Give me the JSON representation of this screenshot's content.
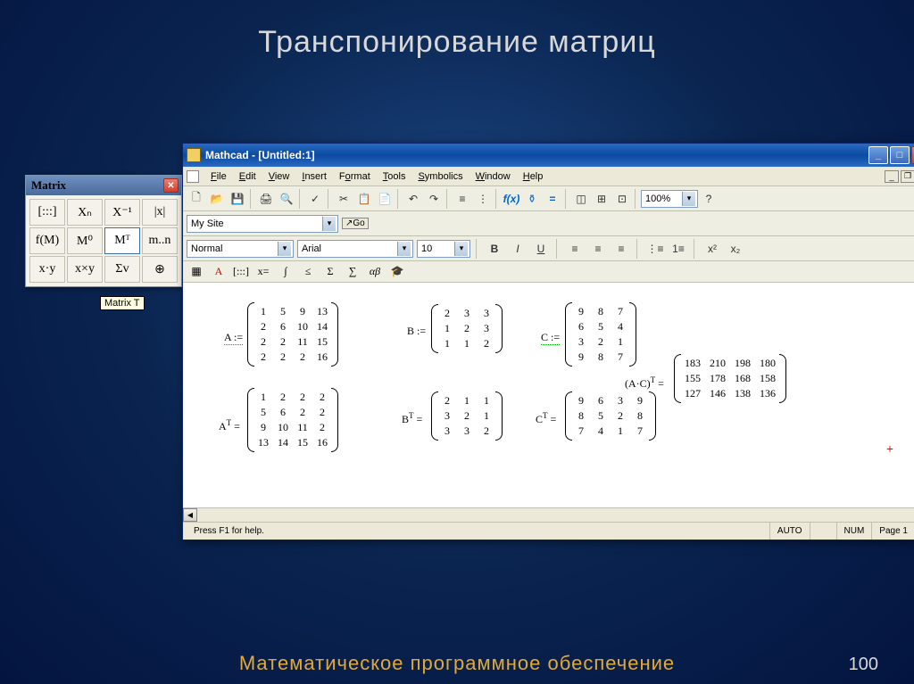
{
  "slide": {
    "title": "Транспонирование матриц",
    "footer": "Математическое программное обеспечение",
    "pagenum": "100"
  },
  "matrix_palette": {
    "title": "Matrix",
    "tooltip": "Matrix T",
    "buttons": [
      "[:::]",
      "Xₙ",
      "X⁻¹",
      "|x|",
      "f(M)",
      "M⁰",
      "Mᵀ",
      "m..n",
      "x·y",
      "x×y",
      "Σv",
      "⊕"
    ]
  },
  "mathcad": {
    "title": "Mathcad - [Untitled:1]",
    "menus": [
      "File",
      "Edit",
      "View",
      "Insert",
      "Format",
      "Tools",
      "Symbolics",
      "Window",
      "Help"
    ],
    "nav_site": "My Site",
    "nav_go": "Go",
    "fmt_style": "Normal",
    "fmt_font": "Arial",
    "fmt_size": "10",
    "zoom": "100%",
    "status_left": "Press F1 for help.",
    "status_auto": "AUTO",
    "status_num": "NUM",
    "status_page": "Page 1"
  },
  "math": {
    "A_label": "A :=",
    "A": [
      [
        "1",
        "5",
        "9",
        "13"
      ],
      [
        "2",
        "6",
        "10",
        "14"
      ],
      [
        "2",
        "2",
        "11",
        "15"
      ],
      [
        "2",
        "2",
        "2",
        "16"
      ]
    ],
    "B_label": "B :=",
    "B": [
      [
        "2",
        "3",
        "3"
      ],
      [
        "1",
        "2",
        "3"
      ],
      [
        "1",
        "1",
        "2"
      ]
    ],
    "C_label": "C :=",
    "C": [
      [
        "9",
        "8",
        "7"
      ],
      [
        "6",
        "5",
        "4"
      ],
      [
        "3",
        "2",
        "1"
      ],
      [
        "9",
        "8",
        "7"
      ]
    ],
    "AT_label": "Aᵀ =",
    "AT": [
      [
        "1",
        "2",
        "2",
        "2"
      ],
      [
        "5",
        "6",
        "2",
        "2"
      ],
      [
        "9",
        "10",
        "11",
        "2"
      ],
      [
        "13",
        "14",
        "15",
        "16"
      ]
    ],
    "BT_label": "Bᵀ =",
    "BT": [
      [
        "2",
        "1",
        "1"
      ],
      [
        "3",
        "2",
        "1"
      ],
      [
        "3",
        "3",
        "2"
      ]
    ],
    "CT_label": "Cᵀ =",
    "CT": [
      [
        "9",
        "6",
        "3",
        "9"
      ],
      [
        "8",
        "5",
        "2",
        "8"
      ],
      [
        "7",
        "4",
        "1",
        "7"
      ]
    ],
    "AC_label": "(A·C)ᵀ =",
    "AC": [
      [
        "183",
        "210",
        "198",
        "180"
      ],
      [
        "155",
        "178",
        "168",
        "158"
      ],
      [
        "127",
        "146",
        "138",
        "136"
      ]
    ]
  }
}
